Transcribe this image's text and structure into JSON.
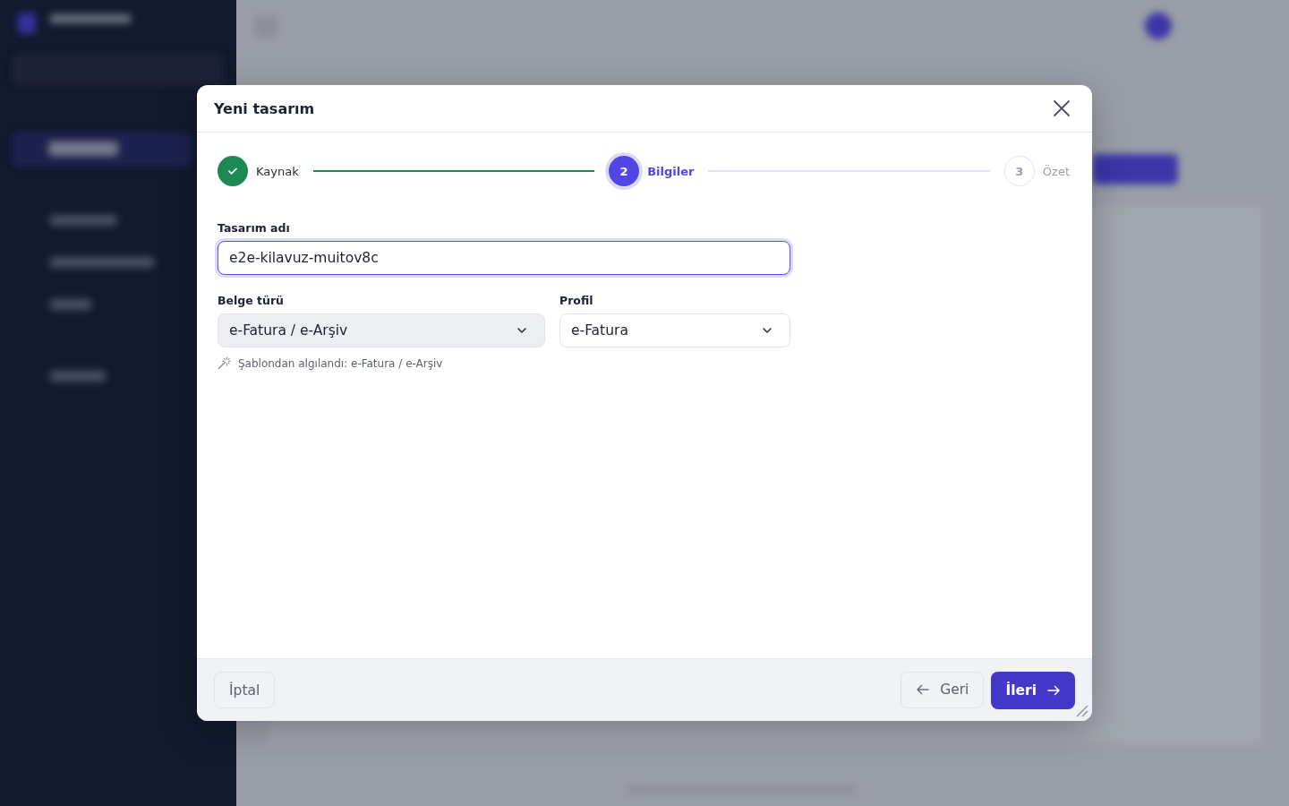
{
  "dialog": {
    "title": "Yeni tasarım"
  },
  "steps": [
    {
      "label": "Kaynak",
      "kind": "done"
    },
    {
      "number": "2",
      "label": "Bilgiler",
      "kind": "current"
    },
    {
      "number": "3",
      "label": "Özet",
      "kind": "upcoming"
    }
  ],
  "name_field": {
    "label": "Tasarım adı",
    "value": "e2e-kilavuz-muitov8c",
    "focused": true
  },
  "document_type": {
    "label": "Belge türü",
    "value": "e-Fatura / e-Arşiv",
    "disabled": true
  },
  "profile": {
    "label": "Profil",
    "value": "e-Fatura",
    "disabled": false
  },
  "hint": "Şablondan algılandı: e-Fatura / e-Arşiv",
  "buttons": [
    {
      "label": "İptal",
      "kind": "cancel"
    },
    {
      "label": "Geri",
      "kind": "back"
    },
    {
      "label": "İleri",
      "kind": "next"
    }
  ]
}
